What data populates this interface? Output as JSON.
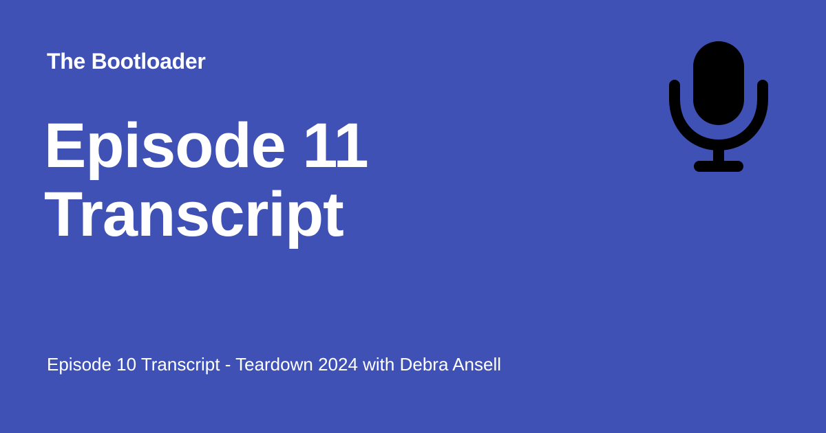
{
  "brand": {
    "name": "The Bootloader",
    "background_color": "#3f51b5",
    "text_color": "#ffffff",
    "icon_color": "#000000"
  },
  "episode": {
    "title_line_1": "Episode 11",
    "title_line_2": "Transcript"
  },
  "previous_episode": {
    "label": "Episode 10 Transcript - Teardown 2024 with Debra Ansell"
  },
  "icons": {
    "primary": "microphone-icon"
  }
}
